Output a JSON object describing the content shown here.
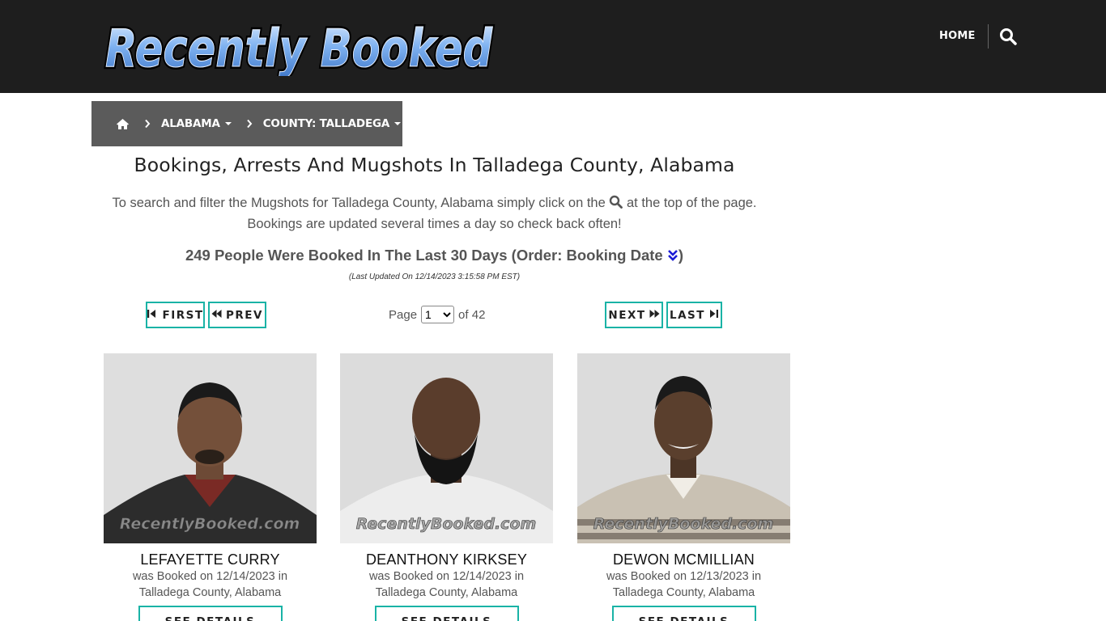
{
  "header": {
    "logo_text": "Recently Booked",
    "nav_home": "HOME",
    "search_icon": "search-icon"
  },
  "breadcrumb": {
    "home_icon": "home-icon",
    "state": "ALABAMA",
    "county": "COUNTY: TALLADEGA"
  },
  "main": {
    "title": "Bookings, Arrests And Mugshots In Talladega County, Alabama",
    "intro_part1": "To search and filter the Mugshots for Talladega County, Alabama simply click on the",
    "intro_part2": "at the top of the page.",
    "intro_line2": "Bookings are updated several times a day so check back often!",
    "count_text": "249 People Were Booked In The Last 30 Days (Order: Booking Date",
    "count_close": ")",
    "last_updated": "(Last Updated On 12/14/2023 3:15:58 PM EST)"
  },
  "pagination": {
    "first": "FIRST",
    "prev": "PREV",
    "page_label": "Page",
    "page_value": "1",
    "of_label": "of 42",
    "next": "NEXT",
    "last": "LAST"
  },
  "cards": [
    {
      "name": "LEFAYETTE CURRY",
      "booked_line1": "was Booked on 12/14/2023 in",
      "booked_line2": "Talladega County, Alabama",
      "watermark": "RecentlyBooked.com",
      "button": "SEE DETAILS"
    },
    {
      "name": "DEANTHONY KIRKSEY",
      "booked_line1": "was Booked on 12/14/2023 in",
      "booked_line2": "Talladega County, Alabama",
      "watermark": "RecentlyBooked.com",
      "button": "SEE DETAILS"
    },
    {
      "name": "DEWON MCMILLIAN",
      "booked_line1": "was Booked on 12/13/2023 in",
      "booked_line2": "Talladega County, Alabama",
      "watermark": "RecentlyBooked.com",
      "button": "SEE DETAILS"
    }
  ],
  "colors": {
    "header_bg": "#1e1e1e",
    "breadcrumb_bg": "#5b5b5b",
    "accent": "#1ab3a6",
    "logo_blue": "#6fa8ee"
  }
}
